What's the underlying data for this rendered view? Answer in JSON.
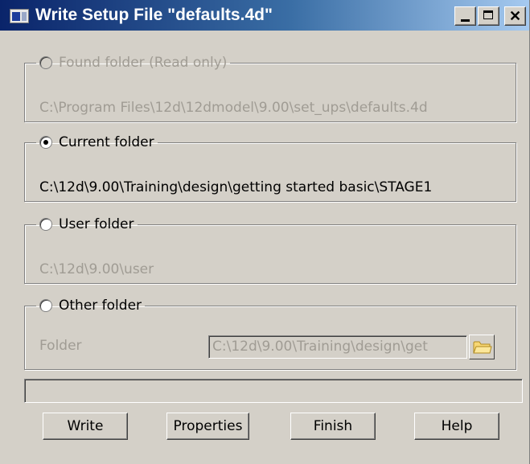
{
  "window": {
    "title": "Write Setup File \"defaults.4d\"",
    "controls": {
      "close_glyph": "✕"
    }
  },
  "found_folder": {
    "label": "Found folder (Read only)",
    "path": "C:\\Program Files\\12d\\12dmodel\\9.00\\set_ups\\defaults.4d",
    "selected": false,
    "enabled": false
  },
  "current_folder": {
    "label": "Current folder",
    "path": "C:\\12d\\9.00\\Training\\design\\getting started basic\\STAGE1",
    "selected": true,
    "enabled": true
  },
  "user_folder": {
    "label": "User folder",
    "path": "C:\\12d\\9.00\\user",
    "selected": false,
    "enabled": false
  },
  "other_folder": {
    "label": "Other folder",
    "folder_label": "Folder",
    "folder_value": "C:\\12d\\9.00\\Training\\design\\get",
    "selected": false
  },
  "status": "",
  "buttons": {
    "write": "Write",
    "properties": "Properties",
    "finish": "Finish",
    "help": "Help"
  },
  "icons": {
    "app": "app-icon",
    "browse": "folder-icon"
  }
}
